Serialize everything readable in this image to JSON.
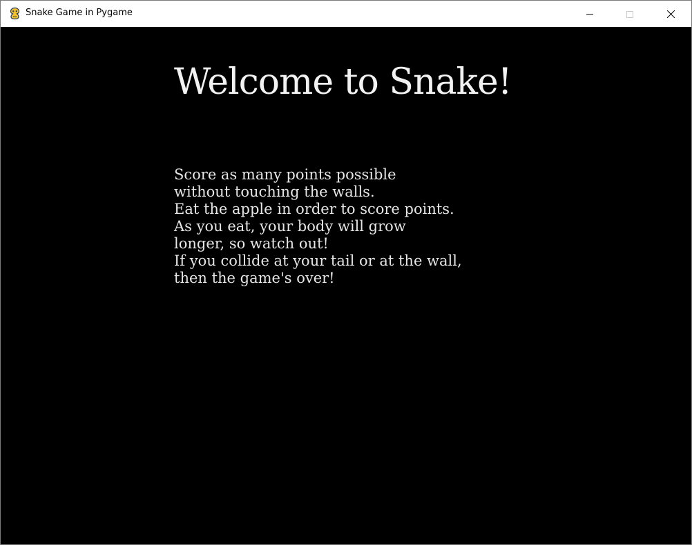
{
  "window": {
    "title": "Snake Game in Pygame",
    "app_icon": "pygame-snake-icon",
    "controls": {
      "minimize_icon": "minimize-icon",
      "maximize_icon": "maximize-icon",
      "close_icon": "close-icon"
    }
  },
  "game": {
    "background_color": "#000000",
    "text_color": "#ffffff",
    "heading": "Welcome to Snake!",
    "instructions": [
      "Score as many points possible",
      "without touching the walls.",
      "Eat the apple in order to score points.",
      "As you eat, your body will grow",
      "longer, so watch out!",
      "If you collide at your tail or at the wall,",
      "then the game's over!"
    ]
  }
}
